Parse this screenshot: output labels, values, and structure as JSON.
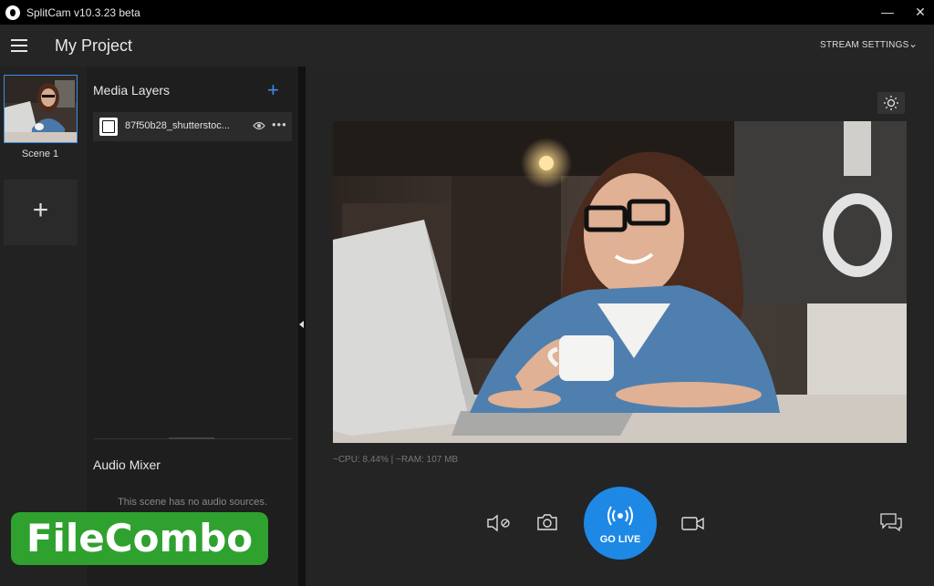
{
  "window": {
    "title": "SplitCam v10.3.23 beta",
    "minimize": "—",
    "close": "✕"
  },
  "header": {
    "project_title": "My Project",
    "stream_settings": "STREAM SETTINGS",
    "chevron": "⌄"
  },
  "scenes": {
    "items": [
      {
        "label": "Scene 1"
      }
    ],
    "add_label": "+"
  },
  "layers": {
    "title": "Media Layers",
    "add_label": "+",
    "items": [
      {
        "name": "87f50b28_shutterstoc...",
        "more": "•••"
      }
    ]
  },
  "audio": {
    "title": "Audio Mixer",
    "empty_text": "This scene has no audio sources."
  },
  "stats": {
    "text": "~CPU: 8.44% | ~RAM: 107 MB"
  },
  "controls": {
    "go_live": "GO LIVE"
  },
  "watermark": {
    "text": "FileCombo"
  },
  "colors": {
    "accent": "#1e88e5",
    "watermark_green": "#2fa12f"
  }
}
